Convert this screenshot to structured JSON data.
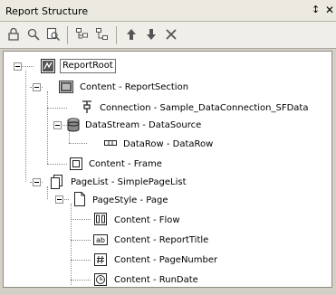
{
  "panel": {
    "title": "Report Structure",
    "pin_glyph": "↕",
    "close_glyph": "✕"
  },
  "toolbar": {
    "buttons": [
      {
        "icon": "lock-icon"
      },
      {
        "icon": "zoom-icon"
      },
      {
        "icon": "find-icon"
      },
      {
        "icon": "expand-tree-icon"
      },
      {
        "icon": "collapse-tree-icon"
      },
      {
        "icon": "move-up-icon"
      },
      {
        "icon": "move-down-icon"
      },
      {
        "icon": "delete-icon"
      }
    ]
  },
  "tree": {
    "items": [
      {
        "label": "ReportRoot",
        "icon": "report-root-icon"
      },
      {
        "label": "Content - ReportSection",
        "icon": "report-section-icon"
      },
      {
        "label": "Connection - Sample_DataConnection_SFData",
        "icon": "connection-icon"
      },
      {
        "label": "DataStream - DataSource",
        "icon": "datastream-icon"
      },
      {
        "label": "DataRow - DataRow",
        "icon": "datarow-icon"
      },
      {
        "label": "Content - Frame",
        "icon": "frame-icon"
      },
      {
        "label": "PageList - SimplePageList",
        "icon": "pagelist-icon"
      },
      {
        "label": "PageStyle - Page",
        "icon": "page-icon"
      },
      {
        "label": "Content - Flow",
        "icon": "flow-icon"
      },
      {
        "label": "Content - ReportTitle",
        "icon": "text-field-icon"
      },
      {
        "label": "Content - PageNumber",
        "icon": "page-number-icon"
      },
      {
        "label": "Content - RunDate",
        "icon": "run-date-icon"
      }
    ]
  }
}
